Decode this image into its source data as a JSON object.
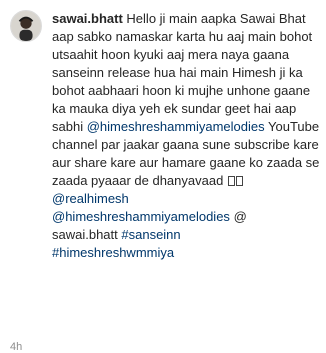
{
  "comment": {
    "username": "sawai.bhatt",
    "text_1": "Hello ji main aapka Sawai Bhat aap sabko namaskar karta hu aaj main bohot utsaahit hoon kyuki aaj mera naya gaana sanseinn release hua hai main Himesh ji ka bohot aabhaari hoon ki mujhe unhone gaane ka mauka diya yeh ek sundar geet hai aap sabhi ",
    "mention_1": "@himeshreshammiyamelodies",
    "text_2": " YouTube channel par jaakar gaana sune subscribe kare aur share kare aur hamare gaane ko zaada se zaada pyaaar de dhanyavaad ",
    "emoji_1": "unsupported-glyph",
    "emoji_2": "unsupported-glyph",
    "mention_2": "@realhimesh",
    "mention_3": "@himeshreshammiyamelodies",
    "mention_4": "@",
    "text_3": "sawai.bhatt ",
    "hashtag_1": "#sanseinn",
    "hashtag_2": "#himeshreshwmmiya",
    "timestamp": "4h"
  },
  "colors": {
    "username": "#262626",
    "body_text": "#262626",
    "link": "#00376b",
    "meta": "#8e8e8e"
  }
}
